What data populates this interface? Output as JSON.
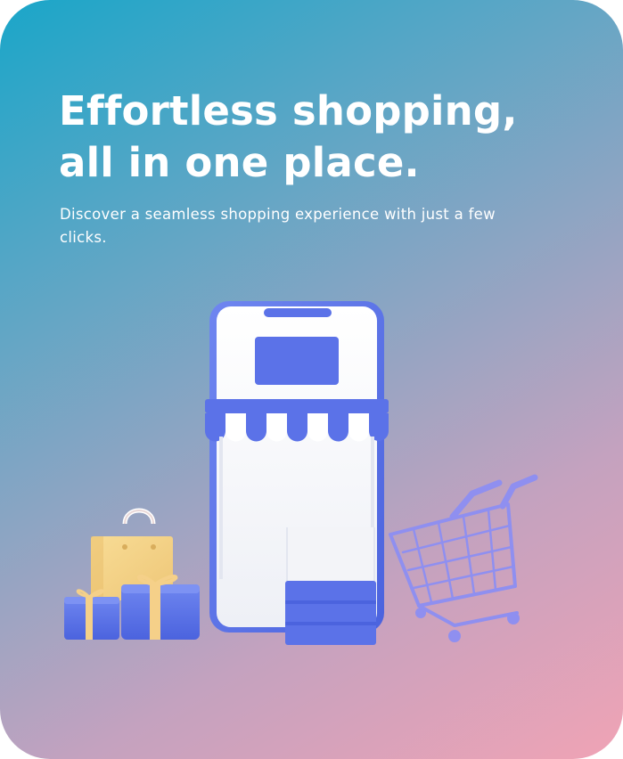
{
  "onboarding": {
    "headline": "Effortless shopping, all in one place.",
    "subtext": "Discover a seamless shopping experience with just a few clicks."
  },
  "icons": [
    "phone-storefront-icon",
    "shopping-bag-icon",
    "gift-box-icon",
    "shopping-cart-icon"
  ],
  "colors": {
    "gradient_start": "#1aa6c9",
    "gradient_end": "#f0a3b5",
    "accent": "#5b72e8",
    "gift_ribbon": "#f5d089"
  }
}
